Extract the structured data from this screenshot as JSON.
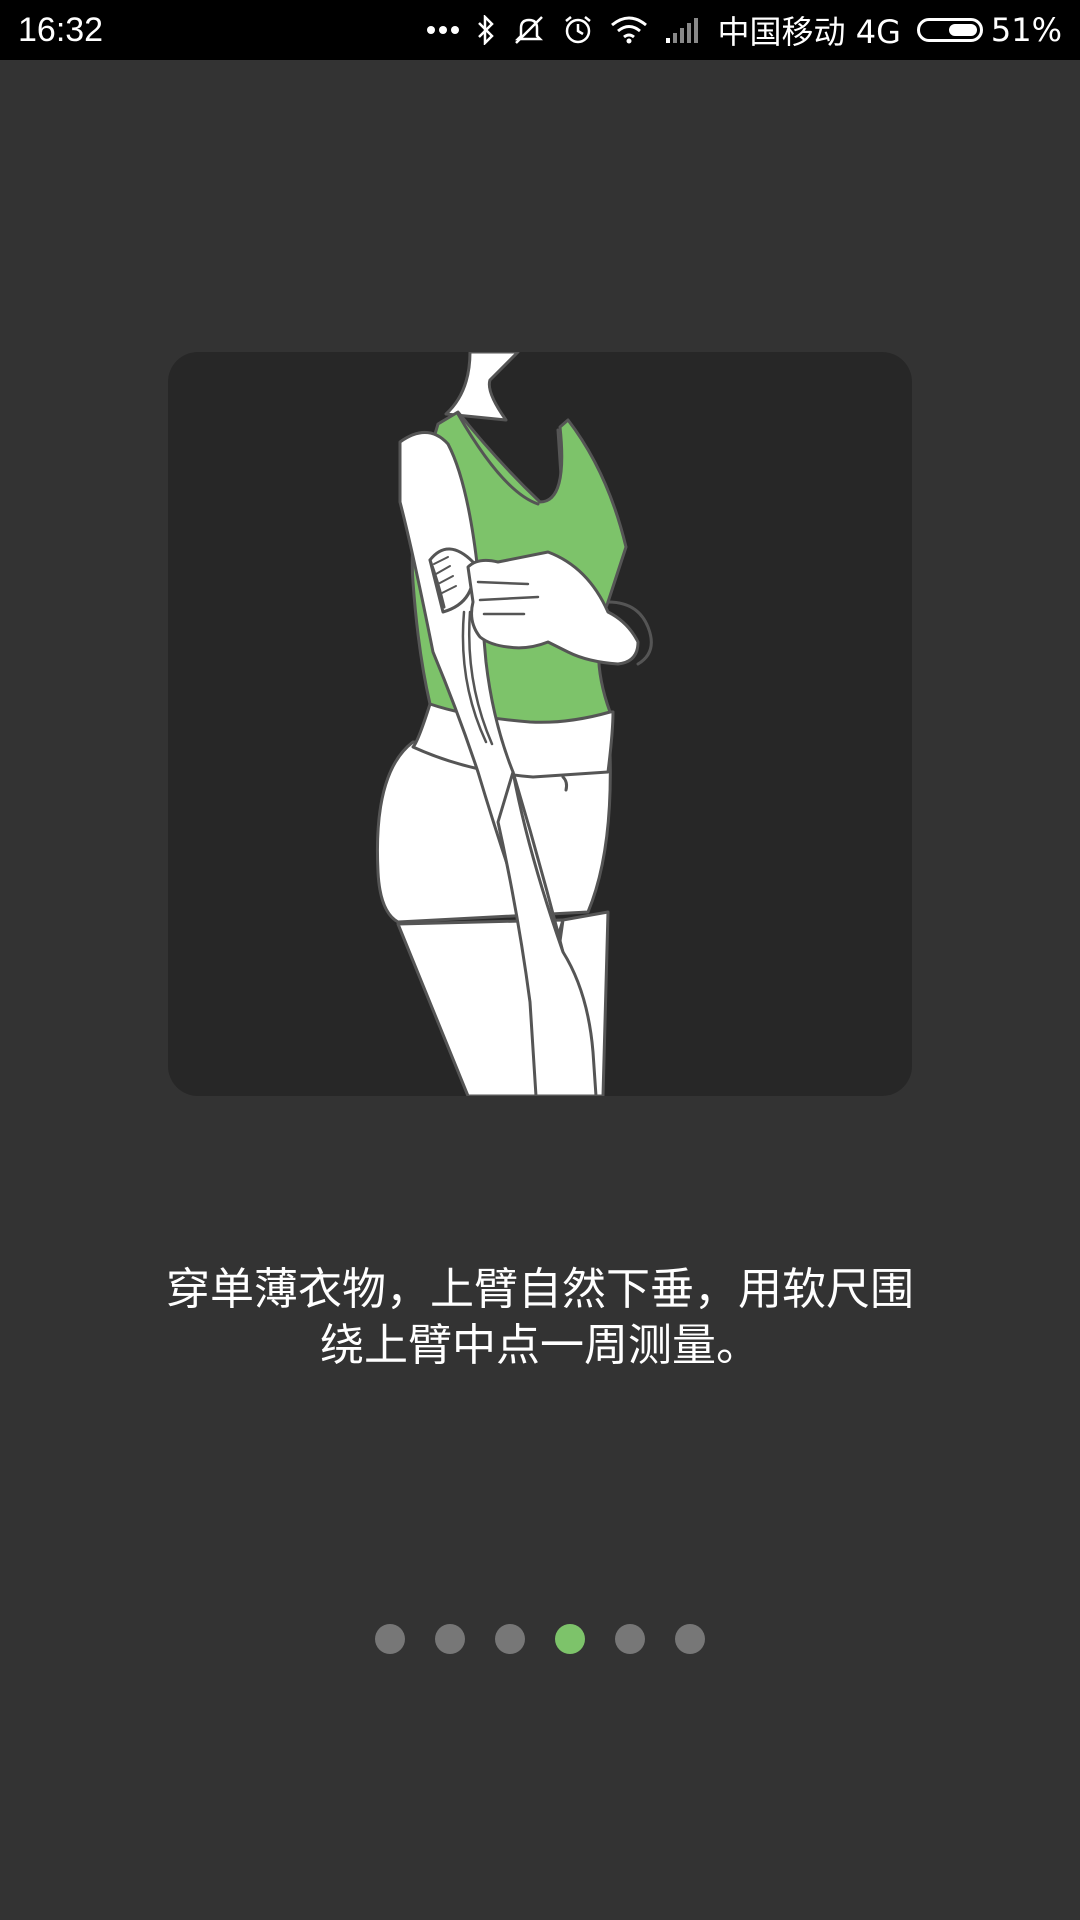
{
  "status_bar": {
    "time": "16:32",
    "carrier": "中国移动 4G",
    "battery": "51%",
    "battery_level": 0.51,
    "icons": [
      "more-dots-icon",
      "bluetooth-icon",
      "mute-icon",
      "alarm-icon",
      "wifi-icon",
      "signal-icon",
      "battery-icon"
    ]
  },
  "illustration": {
    "icon": "upper-arm-measurement-illustration",
    "accent_color": "#7dc36a"
  },
  "instruction": {
    "line1": "穿单薄衣物，上臂自然下垂，用软尺围",
    "line2": "绕上臂中点一周测量。"
  },
  "pager": {
    "total": 6,
    "active_index": 3,
    "active_color": "#7dc36a",
    "inactive_color": "#777777"
  }
}
